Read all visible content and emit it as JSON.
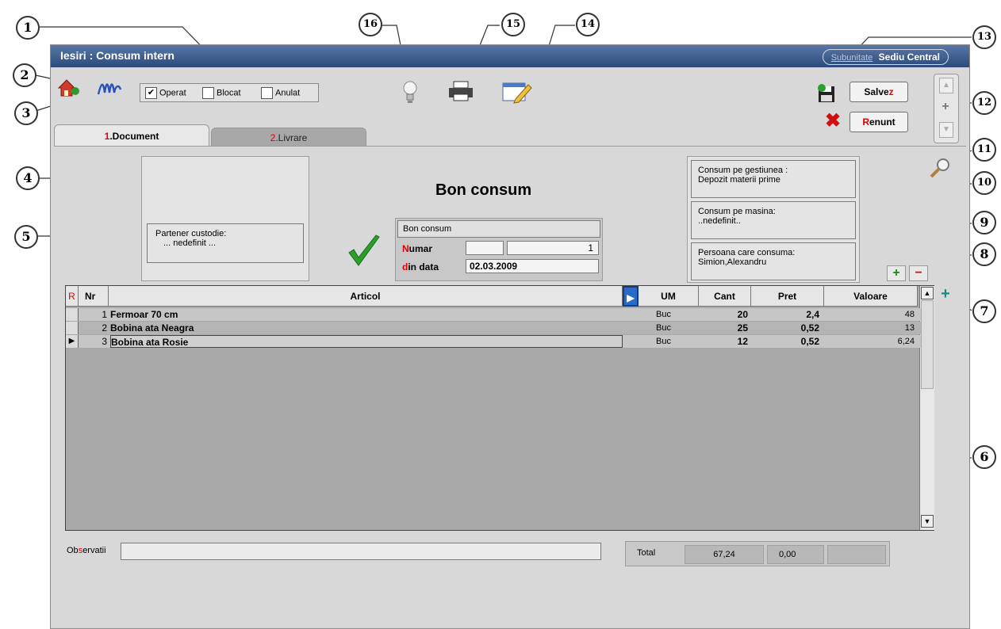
{
  "window": {
    "title": "Iesiri : Consum intern",
    "subunit_label": "Subunitate",
    "subunit_value": "Sediu Central"
  },
  "status_flags": [
    {
      "label": "Operat",
      "checked": true
    },
    {
      "label": "Blocat",
      "checked": false
    },
    {
      "label": "Anulat",
      "checked": false
    }
  ],
  "buttons": {
    "save_prefix": "Salve",
    "save_hotkey": "z",
    "cancel_hotkey": "R",
    "cancel_suffix": "enunt"
  },
  "tabs": [
    {
      "num": "1",
      "label": ".Document",
      "active": true
    },
    {
      "num": "2",
      "label": ".Livrare",
      "active": false
    }
  ],
  "partner": {
    "label": "Partener custodie:",
    "value": "... nedefinit ..."
  },
  "document": {
    "heading": "Bon consum",
    "type": "Bon consum",
    "number_hotkey": "N",
    "number_label": "umar",
    "number_value": "1",
    "date_hotkey": "d",
    "date_label": "in data",
    "date_value": "02.03.2009"
  },
  "info": {
    "gestiune_label": "Consum pe gestiunea :",
    "gestiune_value": "Depozit materii prime",
    "masina_label": "Consum pe masina:",
    "masina_value": "..nedefinit..",
    "persoana_label": "Persoana care consuma:",
    "persoana_value": "Simion,Alexandru"
  },
  "table": {
    "columns": [
      "R",
      "Nr",
      "Articol",
      "UM",
      "Cant",
      "Pret",
      "Valoare"
    ],
    "rows": [
      {
        "nr": "1",
        "articol": "Fermoar 70 cm",
        "um": "Buc",
        "cant": "20",
        "pret": "2,4",
        "valoare": "48"
      },
      {
        "nr": "2",
        "articol": "Bobina ata Neagra",
        "um": "Buc",
        "cant": "25",
        "pret": "0,52",
        "valoare": "13"
      },
      {
        "nr": "3",
        "articol": "Bobina ata Rosie",
        "um": "Buc",
        "cant": "12",
        "pret": "0,52",
        "valoare": "6,24"
      }
    ]
  },
  "footer": {
    "obs_prefix": "Ob",
    "obs_hotkey": "s",
    "obs_suffix": "ervatii",
    "total_label": "Total",
    "total_value": "67,24",
    "total_second": "0,00"
  },
  "callouts": [
    "1",
    "2",
    "3",
    "4",
    "5",
    "6",
    "7",
    "8",
    "9",
    "10",
    "11",
    "12",
    "13",
    "14",
    "15",
    "16"
  ],
  "colors": {
    "titlebar": "#2b4a7c",
    "hotkey": "#e00000",
    "check_green": "#2aa02a"
  }
}
